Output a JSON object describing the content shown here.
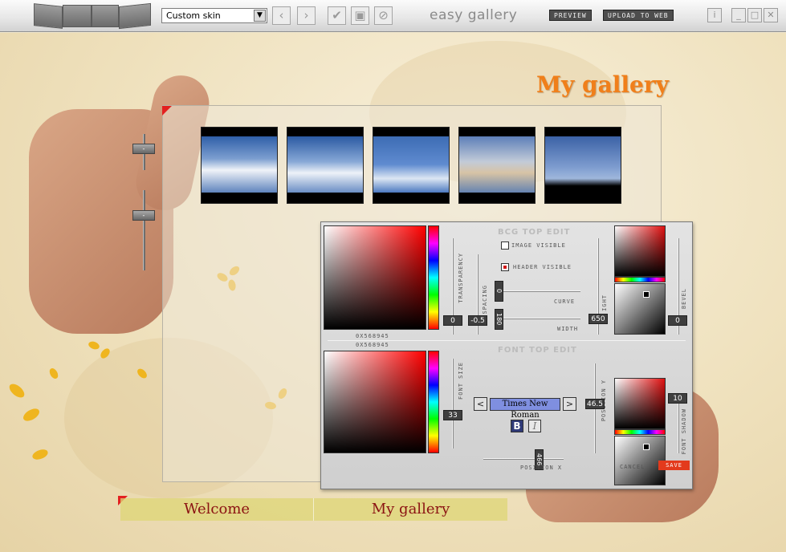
{
  "toolbar": {
    "skin_value": "Custom skin",
    "app_title": "easy gallery",
    "preview_label": "PREVIEW",
    "upload_label": "UPLOAD TO WEB",
    "back_icon": "‹",
    "forward_icon": "›",
    "dropdown_icon": "▼"
  },
  "page": {
    "gallery_title": "My gallery",
    "nav": [
      "Welcome",
      "My gallery"
    ],
    "slider_knob_label": "-"
  },
  "editor": {
    "bcg_title": "BCG TOP EDIT",
    "font_title": "FONT TOP EDIT",
    "color_hex_top": "0X568945",
    "color_hex_bottom": "0X568945",
    "image_visible_label": "IMAGE VISIBLE",
    "image_visible": false,
    "header_visible_label": "HEADER VISIBLE",
    "header_visible": true,
    "transparency_label": "TRANSPARENCY",
    "transparency_value": "0",
    "spacing_label": "SPACING",
    "spacing_value": "-0.5",
    "curve_label": "CURVE",
    "curve_value": "0",
    "width_label": "WIDTH",
    "width_value": "180",
    "height_label": "IGHT",
    "height_value": "650",
    "bevel_label": "BEVEL",
    "bevel_value": "0",
    "font_size_label": "FONT SIZE",
    "font_size_value": "33",
    "font_name": "Times New Roman",
    "bold_label": "B",
    "italic_label": "I",
    "position_x_label": "POSITION X",
    "position_x_value": "466",
    "position_y_label": "POSITION Y",
    "position_y_value": "46.5",
    "font_shadow_label": "FONT SHADOW",
    "font_shadow_value": "10",
    "cancel_label": "CANCEL",
    "save_label": "SAVE"
  },
  "colors": {
    "accent_title": "#f07f1a",
    "nav_text": "#8b1212",
    "save_button": "#e33a1c"
  }
}
